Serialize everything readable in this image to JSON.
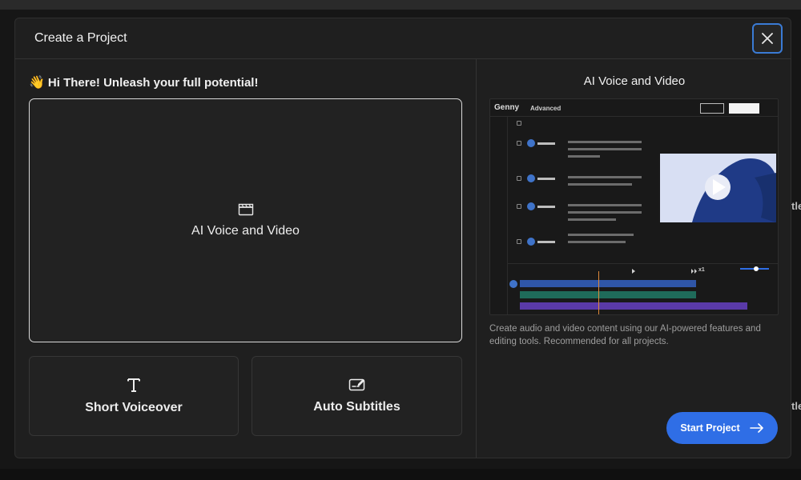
{
  "modal": {
    "title": "Create a Project",
    "close_icon": "close-icon",
    "greeting": "Hi There! Unleash your full potential!",
    "greeting_emoji": "👋"
  },
  "cards": {
    "main": {
      "label": "AI Voice and Video",
      "icon": "clapperboard-icon"
    },
    "short_voiceover": {
      "label": "Short Voiceover",
      "icon": "text-t-icon"
    },
    "auto_subtitles": {
      "label": "Auto Subtitles",
      "icon": "subtitles-edit-icon"
    }
  },
  "preview": {
    "title": "AI Voice and Video",
    "brand": "Genny",
    "badge": "Advanced",
    "speed": "x1",
    "description": "Create audio and video content using our AI-powered features and editing tools. Recommended for all projects."
  },
  "actions": {
    "start_label": "Start Project",
    "start_icon": "arrow-right-icon"
  },
  "background": {
    "right_text_1": "tle",
    "right_text_2": "tle"
  },
  "colors": {
    "accent": "#2f6ee6",
    "close_border": "#3a7bd5",
    "track_blue": "#2f56a8",
    "track_teal": "#1f6b5a",
    "track_purple": "#5a3aa8",
    "playhead": "#e08a3a"
  }
}
